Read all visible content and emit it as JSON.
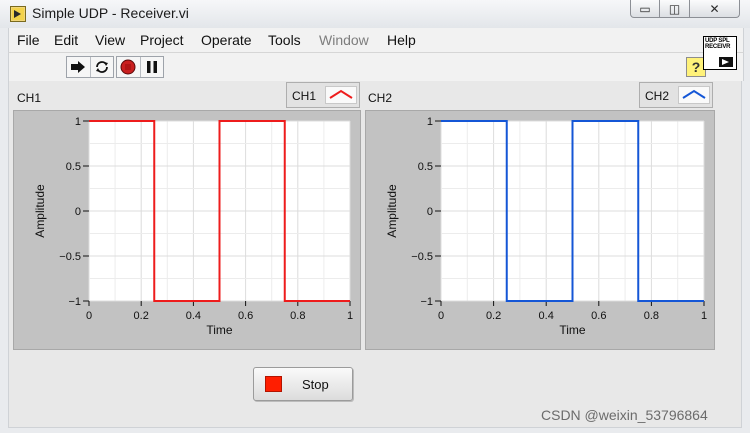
{
  "window": {
    "title": "Simple UDP - Receiver.vi",
    "buttons": {
      "minimize": "▭",
      "maximize": "◫",
      "close": "✕"
    }
  },
  "menu": {
    "items": [
      {
        "label": "File",
        "enabled": true
      },
      {
        "label": "Edit",
        "enabled": true
      },
      {
        "label": "View",
        "enabled": true
      },
      {
        "label": "Project",
        "enabled": true
      },
      {
        "label": "Operate",
        "enabled": true
      },
      {
        "label": "Tools",
        "enabled": true
      },
      {
        "label": "Window",
        "enabled": false
      },
      {
        "label": "Help",
        "enabled": true
      }
    ]
  },
  "toolbar": {
    "buttons": [
      "run-arrow-icon",
      "run-continuously-icon",
      "abort-icon",
      "pause-icon"
    ],
    "help_label": "?"
  },
  "vi_icon": {
    "text": "UDP SPL RECEIVR"
  },
  "graphs": [
    {
      "label": "CH1",
      "legend": "CH1",
      "color": "#ee1c1c",
      "chart_data": {
        "type": "line",
        "x": [
          0,
          0.25,
          0.25,
          0.5,
          0.5,
          0.75,
          0.75,
          1
        ],
        "y": [
          1,
          1,
          -1,
          -1,
          1,
          1,
          -1,
          -1
        ],
        "series": [
          {
            "name": "CH1",
            "color": "#ee1c1c"
          }
        ],
        "xlabel": "Time",
        "ylabel": "Amplitude",
        "xlim": [
          0,
          1
        ],
        "ylim": [
          -1,
          1
        ],
        "xticks": [
          "0",
          "0.2",
          "0.4",
          "0.6",
          "0.8",
          "1"
        ],
        "yticks": [
          "1",
          "0.5",
          "0",
          "-0.5",
          "-1"
        ],
        "grid": true
      }
    },
    {
      "label": "CH2",
      "legend": "CH2",
      "color": "#1456d6",
      "chart_data": {
        "type": "line",
        "x": [
          0,
          0.25,
          0.25,
          0.5,
          0.5,
          0.75,
          0.75,
          1
        ],
        "y": [
          1,
          1,
          -1,
          -1,
          1,
          1,
          -1,
          -1
        ],
        "series": [
          {
            "name": "CH2",
            "color": "#1456d6"
          }
        ],
        "xlabel": "Time",
        "ylabel": "Amplitude",
        "xlim": [
          0,
          1
        ],
        "ylim": [
          -1,
          1
        ],
        "xticks": [
          "0",
          "0.2",
          "0.4",
          "0.6",
          "0.8",
          "1"
        ],
        "yticks": [
          "1",
          "0.5",
          "0",
          "-0.5",
          "-1"
        ],
        "grid": true
      }
    }
  ],
  "stop_button": {
    "label": "Stop",
    "led_color": "#ff1e00"
  },
  "watermark": "CSDN @weixin_53796864"
}
